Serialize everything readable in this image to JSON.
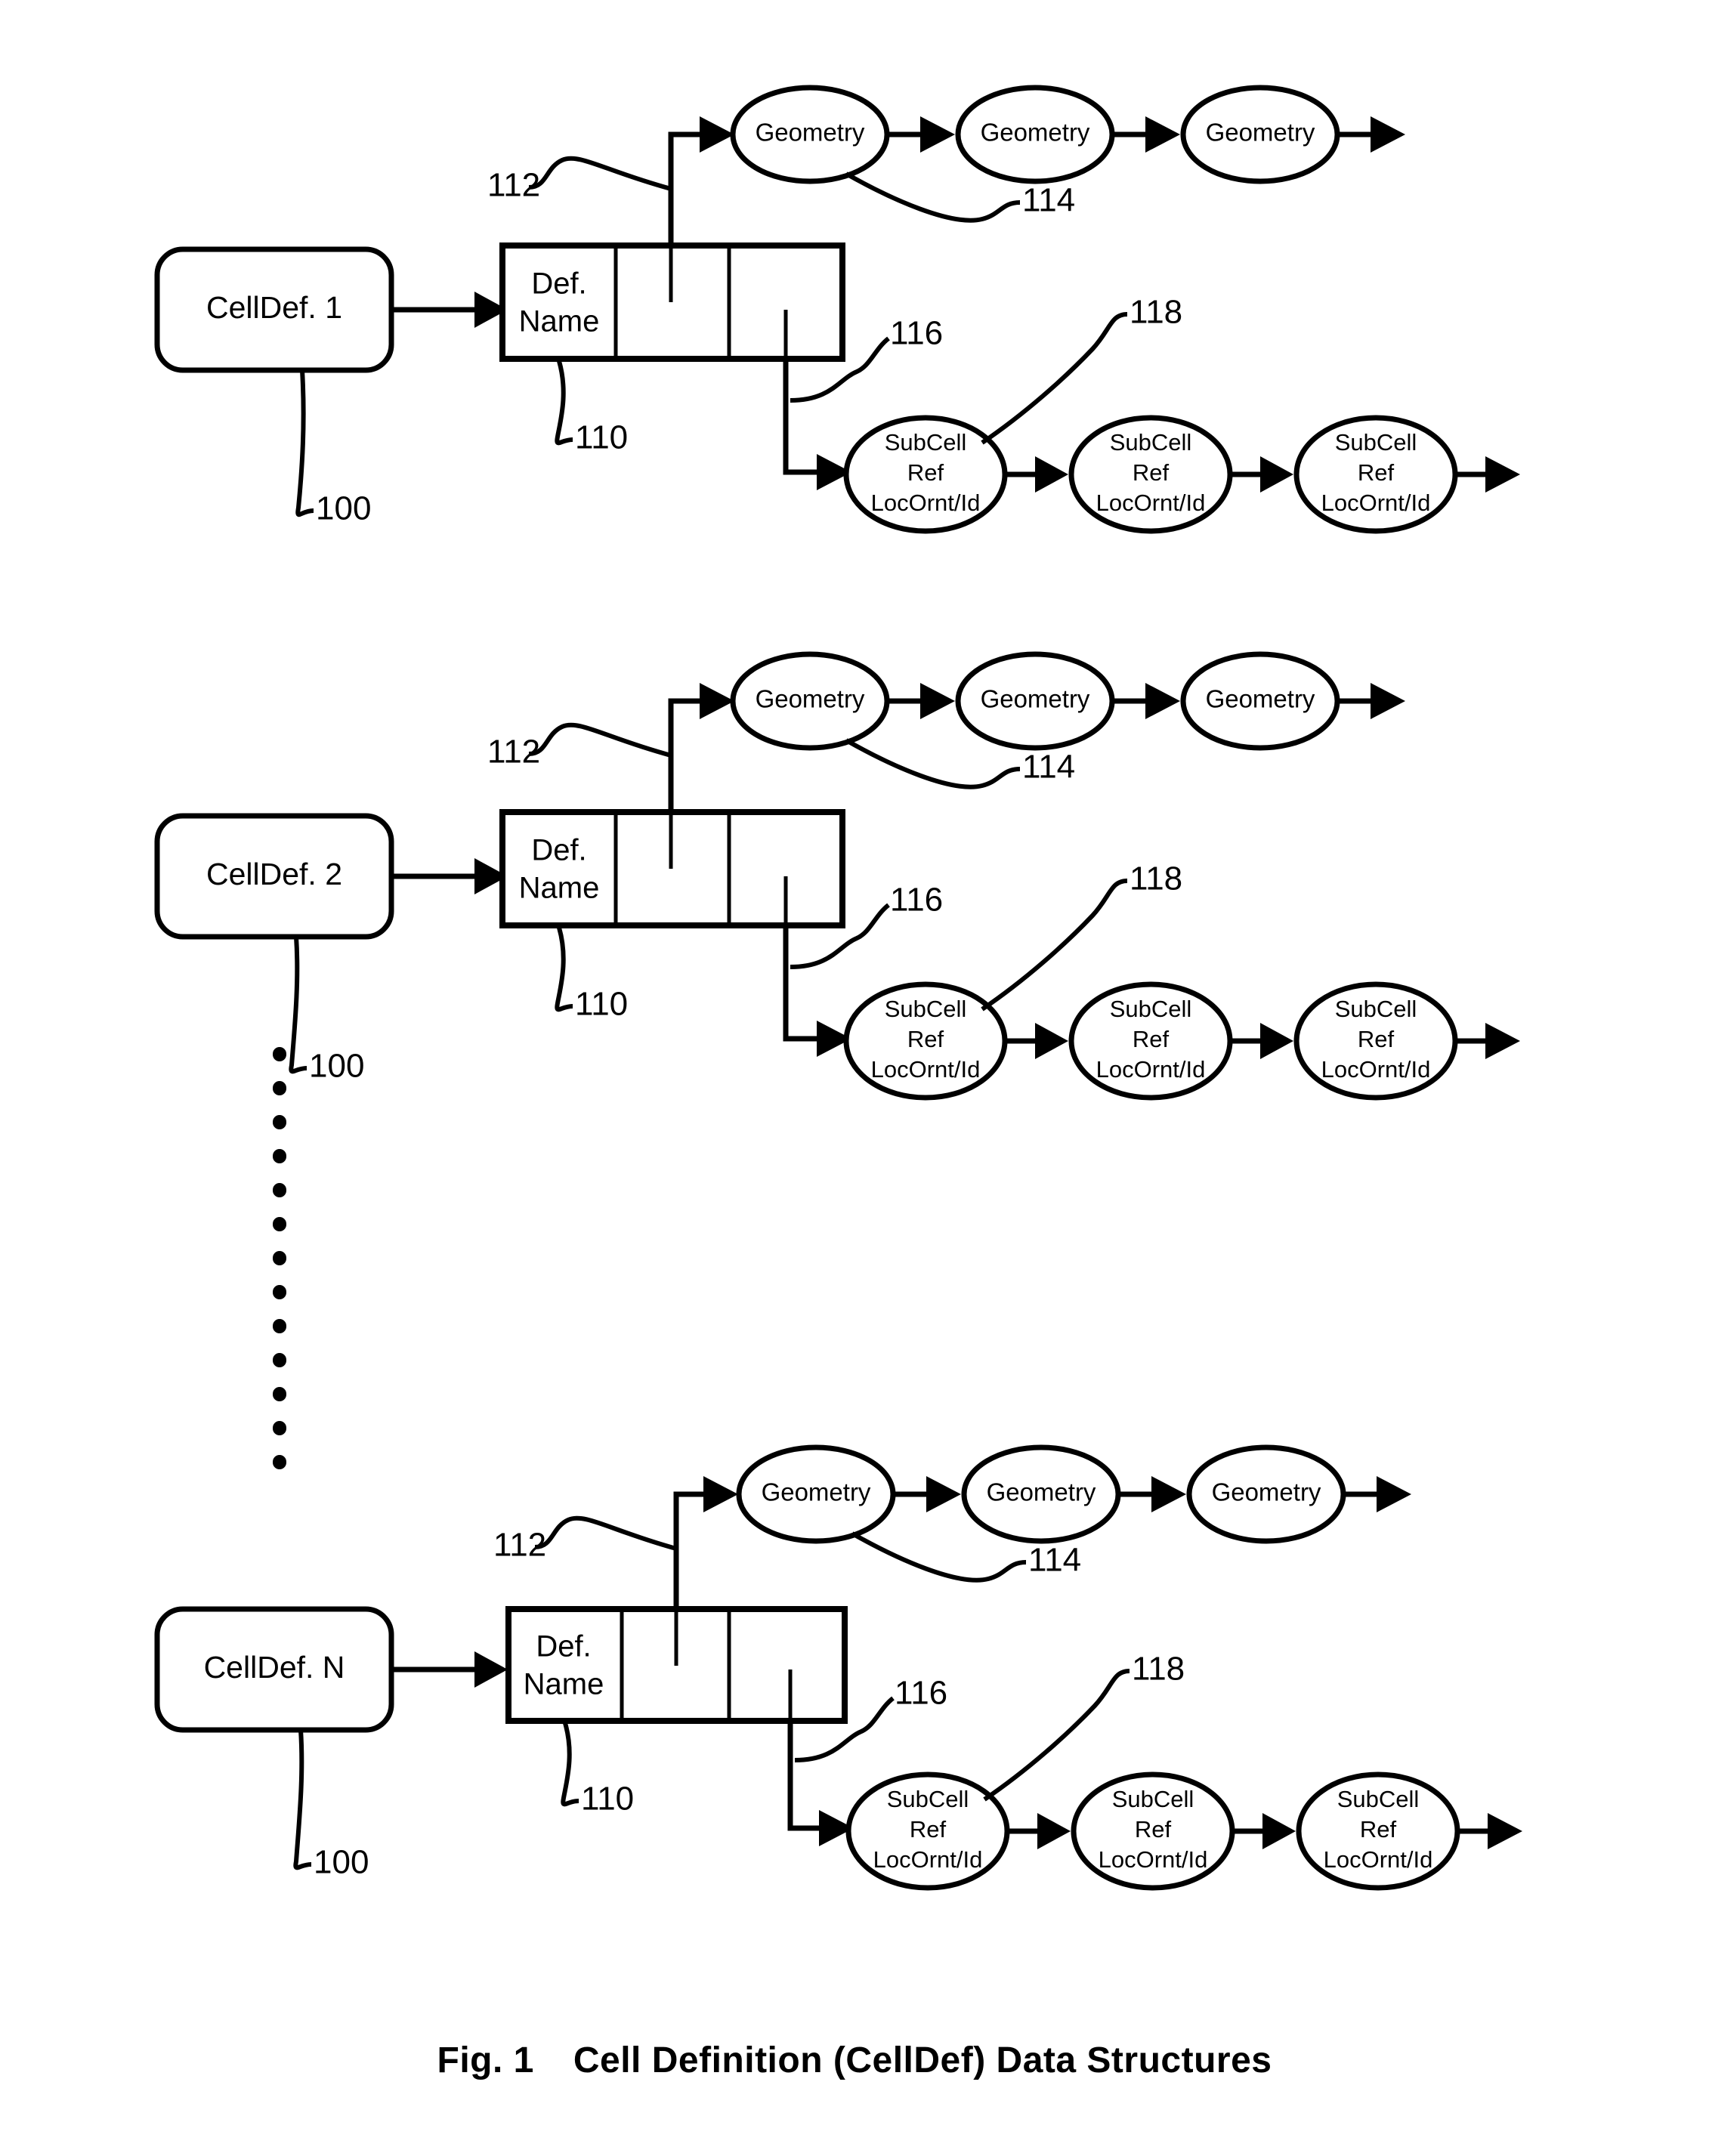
{
  "figure": {
    "caption_prefix": "Fig. 1",
    "caption_text": "Cell Definition (CellDef) Data Structures",
    "background_color": "#ffffff",
    "line_color": "#000000"
  },
  "reference_numerals": {
    "celldef": "100",
    "def_record": "110",
    "geometry_pointer": "112",
    "geometry_node": "114",
    "subcell_pointer": "116",
    "subcell_node": "118"
  },
  "rows": [
    {
      "id": "row-1",
      "celldef_label": "CellDef. 1",
      "record": {
        "field_line_1": "Def.",
        "field_line_2": "Name",
        "fields": [
          "Def. Name",
          "",
          ""
        ]
      },
      "geometry_chain": [
        "Geometry",
        "Geometry",
        "Geometry"
      ],
      "subcell_chain": [
        {
          "line_1": "SubCell",
          "line_2": "Ref",
          "line_3": "LocOrnt/Id"
        },
        {
          "line_1": "SubCell",
          "line_2": "Ref",
          "line_3": "LocOrnt/Id"
        },
        {
          "line_1": "SubCell",
          "line_2": "Ref",
          "line_3": "LocOrnt/Id"
        }
      ],
      "callouts": {
        "celldef": "100",
        "record": "110",
        "geometry_pointer": "112",
        "geometry_node": "114",
        "subcell_pointer": "116",
        "subcell_node": "118"
      }
    },
    {
      "id": "row-2",
      "celldef_label": "CellDef. 2",
      "record": {
        "field_line_1": "Def.",
        "field_line_2": "Name",
        "fields": [
          "Def. Name",
          "",
          ""
        ]
      },
      "geometry_chain": [
        "Geometry",
        "Geometry",
        "Geometry"
      ],
      "subcell_chain": [
        {
          "line_1": "SubCell",
          "line_2": "Ref",
          "line_3": "LocOrnt/Id"
        },
        {
          "line_1": "SubCell",
          "line_2": "Ref",
          "line_3": "LocOrnt/Id"
        },
        {
          "line_1": "SubCell",
          "line_2": "Ref",
          "line_3": "LocOrnt/Id"
        }
      ],
      "callouts": {
        "celldef": "100",
        "record": "110",
        "geometry_pointer": "112",
        "geometry_node": "114",
        "subcell_pointer": "116",
        "subcell_node": "118"
      }
    },
    {
      "id": "row-3",
      "celldef_label": "CellDef. N",
      "record": {
        "field_line_1": "Def.",
        "field_line_2": "Name",
        "fields": [
          "Def. Name",
          "",
          ""
        ]
      },
      "geometry_chain": [
        "Geometry",
        "Geometry",
        "Geometry"
      ],
      "subcell_chain": [
        {
          "line_1": "SubCell",
          "line_2": "Ref",
          "line_3": "LocOrnt/Id"
        },
        {
          "line_1": "SubCell",
          "line_2": "Ref",
          "line_3": "LocOrnt/Id"
        },
        {
          "line_1": "SubCell",
          "line_2": "Ref",
          "line_3": "LocOrnt/Id"
        }
      ],
      "callouts": {
        "celldef": "100",
        "record": "110",
        "geometry_pointer": "112",
        "geometry_node": "114",
        "subcell_pointer": "116",
        "subcell_node": "118"
      }
    }
  ],
  "ellipsis": {
    "style": "vertical-dotted-line",
    "meaning": "continuation between CellDef. 2 and CellDef. N"
  }
}
